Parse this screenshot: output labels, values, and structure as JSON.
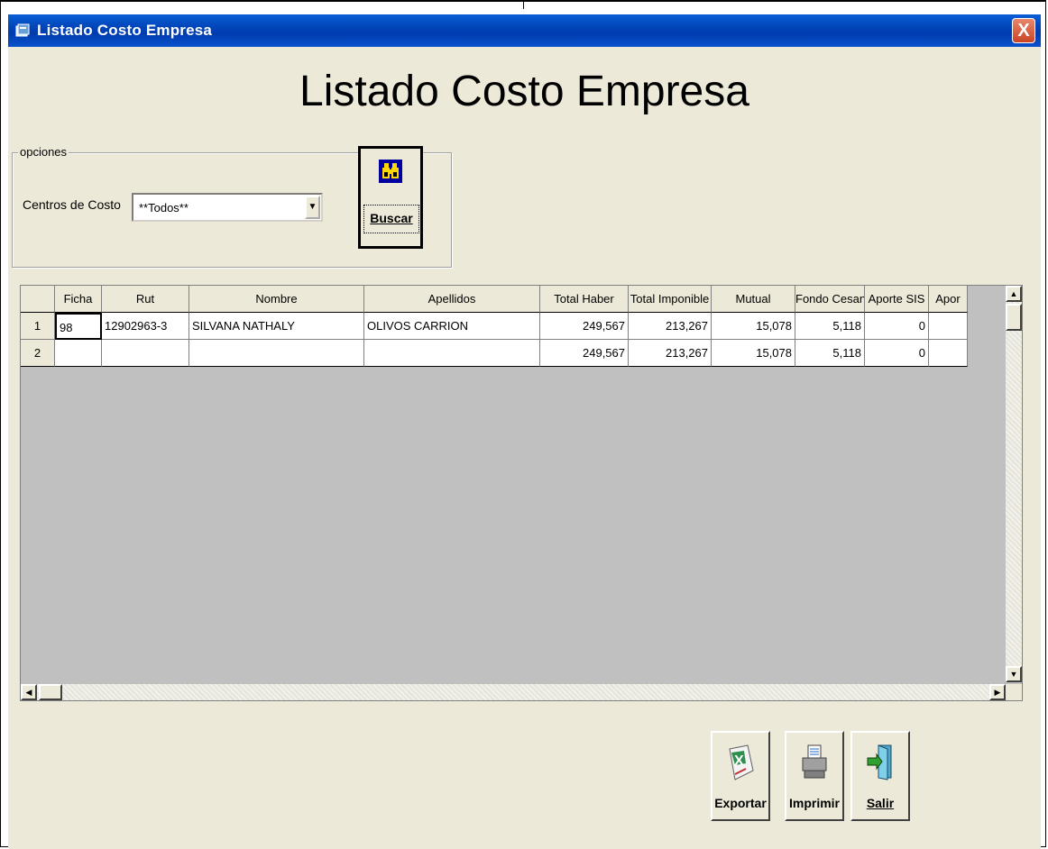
{
  "window": {
    "title": "Listado Costo Empresa",
    "close_glyph": "X"
  },
  "heading": "Listado Costo Empresa",
  "options": {
    "legend": "opciones",
    "centros_label": "Centros de Costo",
    "centros_value": "**Todos**"
  },
  "buttons": {
    "buscar": "Buscar",
    "exportar": "Exportar",
    "imprimir": "Imprimir",
    "salir": "Salir"
  },
  "grid": {
    "columns": [
      "",
      "Ficha",
      "Rut",
      "Nombre",
      "Apellidos",
      "Total Haber",
      "Total Imponible",
      "Mutual",
      "Fondo Cesantia",
      "Aporte SIS",
      "Apor"
    ],
    "rows": [
      [
        "1",
        "98",
        "12902963-3",
        "SILVANA NATHALY",
        "OLIVOS CARRION",
        "249,567",
        "213,267",
        "15,078",
        "5,118",
        "0",
        ""
      ],
      [
        "2",
        "",
        "",
        "",
        "",
        "249,567",
        "213,267",
        "15,078",
        "5,118",
        "0",
        ""
      ]
    ]
  },
  "icons": {
    "app": "window-icon",
    "buscar": "binoculars-icon",
    "exportar": "excel-icon",
    "imprimir": "printer-icon",
    "salir": "exit-door-icon"
  },
  "colors": {
    "titlebar": "#0054e3",
    "window_bg": "#ece9d8",
    "grid_empty": "#c0c0c0"
  }
}
